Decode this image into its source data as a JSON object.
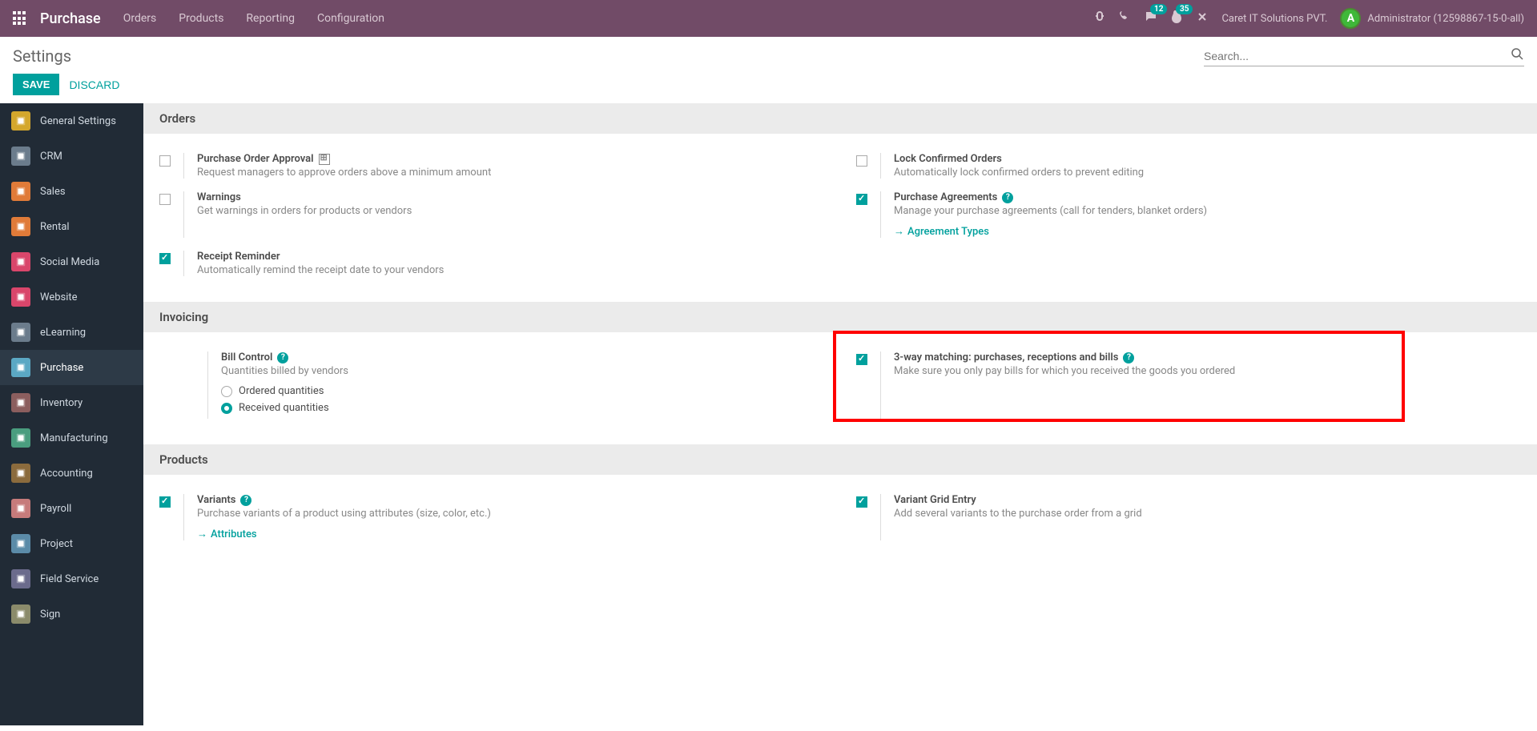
{
  "topnav": {
    "brand": "Purchase",
    "menu": [
      "Orders",
      "Products",
      "Reporting",
      "Configuration"
    ],
    "messaging_badge": "12",
    "activity_badge": "35",
    "company": "Caret IT Solutions PVT.",
    "user": "Administrator (12598867-15-0-all)",
    "avatar_letter": "A"
  },
  "control_panel": {
    "title": "Settings",
    "save": "SAVE",
    "discard": "DISCARD",
    "search_placeholder": "Search..."
  },
  "sidebar": [
    {
      "label": "General Settings",
      "color": "#d4a72c"
    },
    {
      "label": "CRM",
      "color": "#6b7c8c"
    },
    {
      "label": "Sales",
      "color": "#e07b39"
    },
    {
      "label": "Rental",
      "color": "#e07b39"
    },
    {
      "label": "Social Media",
      "color": "#d9466b"
    },
    {
      "label": "Website",
      "color": "#d9466b"
    },
    {
      "label": "eLearning",
      "color": "#6b7c8c"
    },
    {
      "label": "Purchase",
      "color": "#5ba8c4",
      "active": true
    },
    {
      "label": "Inventory",
      "color": "#8b5e5e"
    },
    {
      "label": "Manufacturing",
      "color": "#4a9d7f"
    },
    {
      "label": "Accounting",
      "color": "#8b6b3d"
    },
    {
      "label": "Payroll",
      "color": "#c67b7b"
    },
    {
      "label": "Project",
      "color": "#5b8ba8"
    },
    {
      "label": "Field Service",
      "color": "#6b6b8c"
    },
    {
      "label": "Sign",
      "color": "#8b8b6b"
    }
  ],
  "sections": {
    "orders": {
      "title": "Orders",
      "po_approval": {
        "title": "Purchase Order Approval",
        "desc": "Request managers to approve orders above a minimum amount",
        "checked": false
      },
      "lock_confirmed": {
        "title": "Lock Confirmed Orders",
        "desc": "Automatically lock confirmed orders to prevent editing",
        "checked": false
      },
      "warnings": {
        "title": "Warnings",
        "desc": "Get warnings in orders for products or vendors",
        "checked": false
      },
      "agreements": {
        "title": "Purchase Agreements",
        "desc": "Manage your purchase agreements (call for tenders, blanket orders)",
        "checked": true,
        "link": "Agreement Types"
      },
      "receipt_reminder": {
        "title": "Receipt Reminder",
        "desc": "Automatically remind the receipt date to your vendors",
        "checked": true
      }
    },
    "invoicing": {
      "title": "Invoicing",
      "bill_control": {
        "title": "Bill Control",
        "desc": "Quantities billed by vendors",
        "opt1": "Ordered quantities",
        "opt2": "Received quantities"
      },
      "three_way": {
        "title": "3-way matching: purchases, receptions and bills",
        "desc": "Make sure you only pay bills for which you received the goods you ordered",
        "checked": true
      }
    },
    "products": {
      "title": "Products",
      "variants": {
        "title": "Variants",
        "desc": "Purchase variants of a product using attributes (size, color, etc.)",
        "checked": true,
        "link": "Attributes"
      },
      "variant_grid": {
        "title": "Variant Grid Entry",
        "desc": "Add several variants to the purchase order from a grid",
        "checked": true
      }
    }
  }
}
